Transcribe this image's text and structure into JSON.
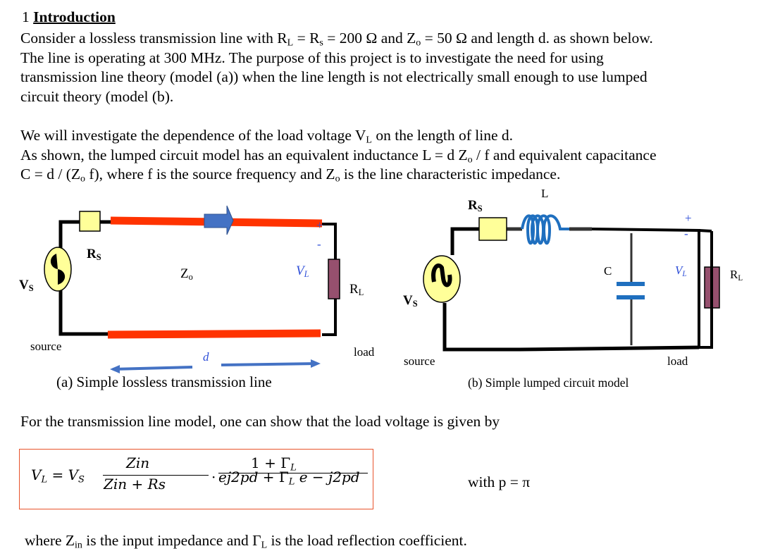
{
  "heading": {
    "number": "1",
    "title": "Introduction"
  },
  "intro_lines": [
    "Consider a lossless transmission line with R",
    "The line is operating at 300 MHz.  The purpose of this project is to investigate the need for using",
    "transmission line theory (model (a)) when the line length is not electrically small enough to use lumped",
    "circuit theory (model (b)."
  ],
  "intro_line1": {
    "p1": "Consider a lossless transmission line with R",
    "sub_l": "L",
    "p2": " = R",
    "sub_s": "s",
    "p3": " = 200 Ω and Z",
    "sub_o": "o",
    "p4": " = 50 Ω and length d. as shown below."
  },
  "para2": {
    "line1_a": "We will investigate the dependence of the load voltage V",
    "line1_sub": "L",
    "line1_b": " on the length of line d.",
    "line2_a": "As shown, the lumped circuit model has an equivalent inductance L = d Z",
    "line2_sub": "o",
    "line2_b": " / f and equivalent capacitance",
    "line3_a": "C = d / (Z",
    "line3_sub": "o",
    "line3_b": " f), where f is the source frequency and Z",
    "line3_sub2": "o",
    "line3_c": " is the line characteristic impedance."
  },
  "figure_a": {
    "source_label": "V",
    "source_sub": "S",
    "rs_label": "R",
    "rs_sub": "S",
    "z_label": "Z",
    "z_sub": "o",
    "vl_label": "V",
    "vl_sub": "L",
    "plus": "+",
    "minus": "-",
    "rl_label": "R",
    "rl_sub": "L",
    "source_text": "source",
    "load_text": "load",
    "d_label": "d",
    "caption": "(a) Simple lossless transmission line",
    "colors": {
      "line": "#ff3300",
      "arrow": "#4472c4",
      "resistor_s": "#ffff99",
      "resistor_l": "#96506e"
    }
  },
  "figure_b": {
    "source_label": "V",
    "source_sub": "S",
    "rs_label": "R",
    "rs_sub": "S",
    "l_label": "L",
    "c_label": "C",
    "vl_label": "V",
    "vl_sub": "L",
    "plus": "+",
    "minus": "-",
    "rl_label": "R",
    "rl_sub": "L",
    "source_text": "source",
    "load_text": "load",
    "caption": "(b) Simple lumped circuit model",
    "colors": {
      "inductor": "#1f6fbf",
      "capacitor": "#1f6fbf"
    }
  },
  "para3": "For the transmission line model, one can show that the load voltage is given by",
  "equation": {
    "lhs": "V",
    "lhs_sub": "L",
    "eq": " = ",
    "vs": "V",
    "vs_sub": "S",
    "frac1_num": "Z",
    "frac1_num_sub": "in",
    "frac1_den_a": "Z",
    "frac1_den_sub": "in",
    "frac1_den_b": " + Rs",
    "dot": "·",
    "frac2_num": "1 + Γ",
    "frac2_num_sub": "L",
    "frac2_den_a": "e",
    "frac2_den_sup": "j2pd",
    "frac2_den_b": " + Γ",
    "frac2_den_sub": "L",
    "frac2_den_c": " e",
    "frac2_den_sup2": " − j2pd"
  },
  "with_text": "with p = π",
  "where": {
    "a": "where  Z",
    "sub_in": "in",
    "b": " is the input impedance and Γ",
    "sub_l": "L",
    "c": "   is the load reflection coefficient."
  }
}
